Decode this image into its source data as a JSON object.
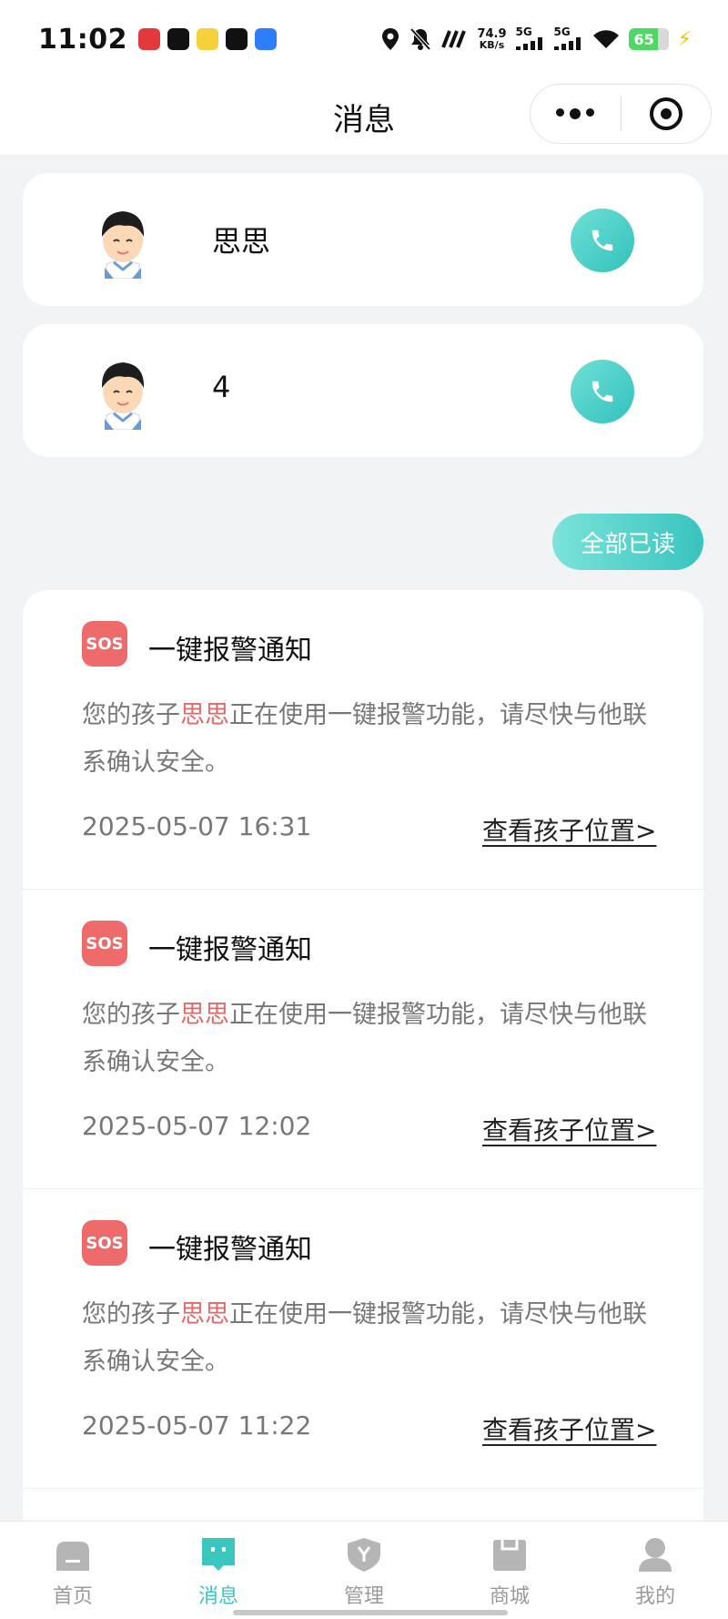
{
  "status_bar": {
    "time": "11:02",
    "net_speed_value": "74.9",
    "net_speed_unit": "KB/s",
    "signal_1": "5G",
    "signal_2": "5G",
    "battery": "65"
  },
  "nav": {
    "title": "消息"
  },
  "contacts": [
    {
      "name": "思思"
    },
    {
      "name": "4"
    }
  ],
  "read_all_label": "全部已读",
  "notices": [
    {
      "badge": "SOS",
      "title": "一键报警通知",
      "body_prefix": "您的孩子",
      "child_name": "思思",
      "body_suffix": "正在使用一键报警功能，请尽快与他联系确认安全。",
      "time": "2025-05-07 16:31",
      "link": "查看孩子位置>"
    },
    {
      "badge": "SOS",
      "title": "一键报警通知",
      "body_prefix": "您的孩子",
      "child_name": "思思",
      "body_suffix": "正在使用一键报警功能，请尽快与他联系确认安全。",
      "time": "2025-05-07 12:02",
      "link": "查看孩子位置>"
    },
    {
      "badge": "SOS",
      "title": "一键报警通知",
      "body_prefix": "您的孩子",
      "child_name": "思思",
      "body_suffix": "正在使用一键报警功能，请尽快与他联系确认安全。",
      "time": "2025-05-07 11:22",
      "link": "查看孩子位置>"
    }
  ],
  "tabs": [
    {
      "label": "首页",
      "icon": "home-icon"
    },
    {
      "label": "消息",
      "icon": "message-icon",
      "active": true
    },
    {
      "label": "管理",
      "icon": "shield-icon"
    },
    {
      "label": "商城",
      "icon": "shop-icon"
    },
    {
      "label": "我的",
      "icon": "profile-icon"
    }
  ],
  "colors": {
    "accent": "#3cc6c0",
    "sos": "#ef6b6b",
    "child_name": "#e06a6a"
  }
}
